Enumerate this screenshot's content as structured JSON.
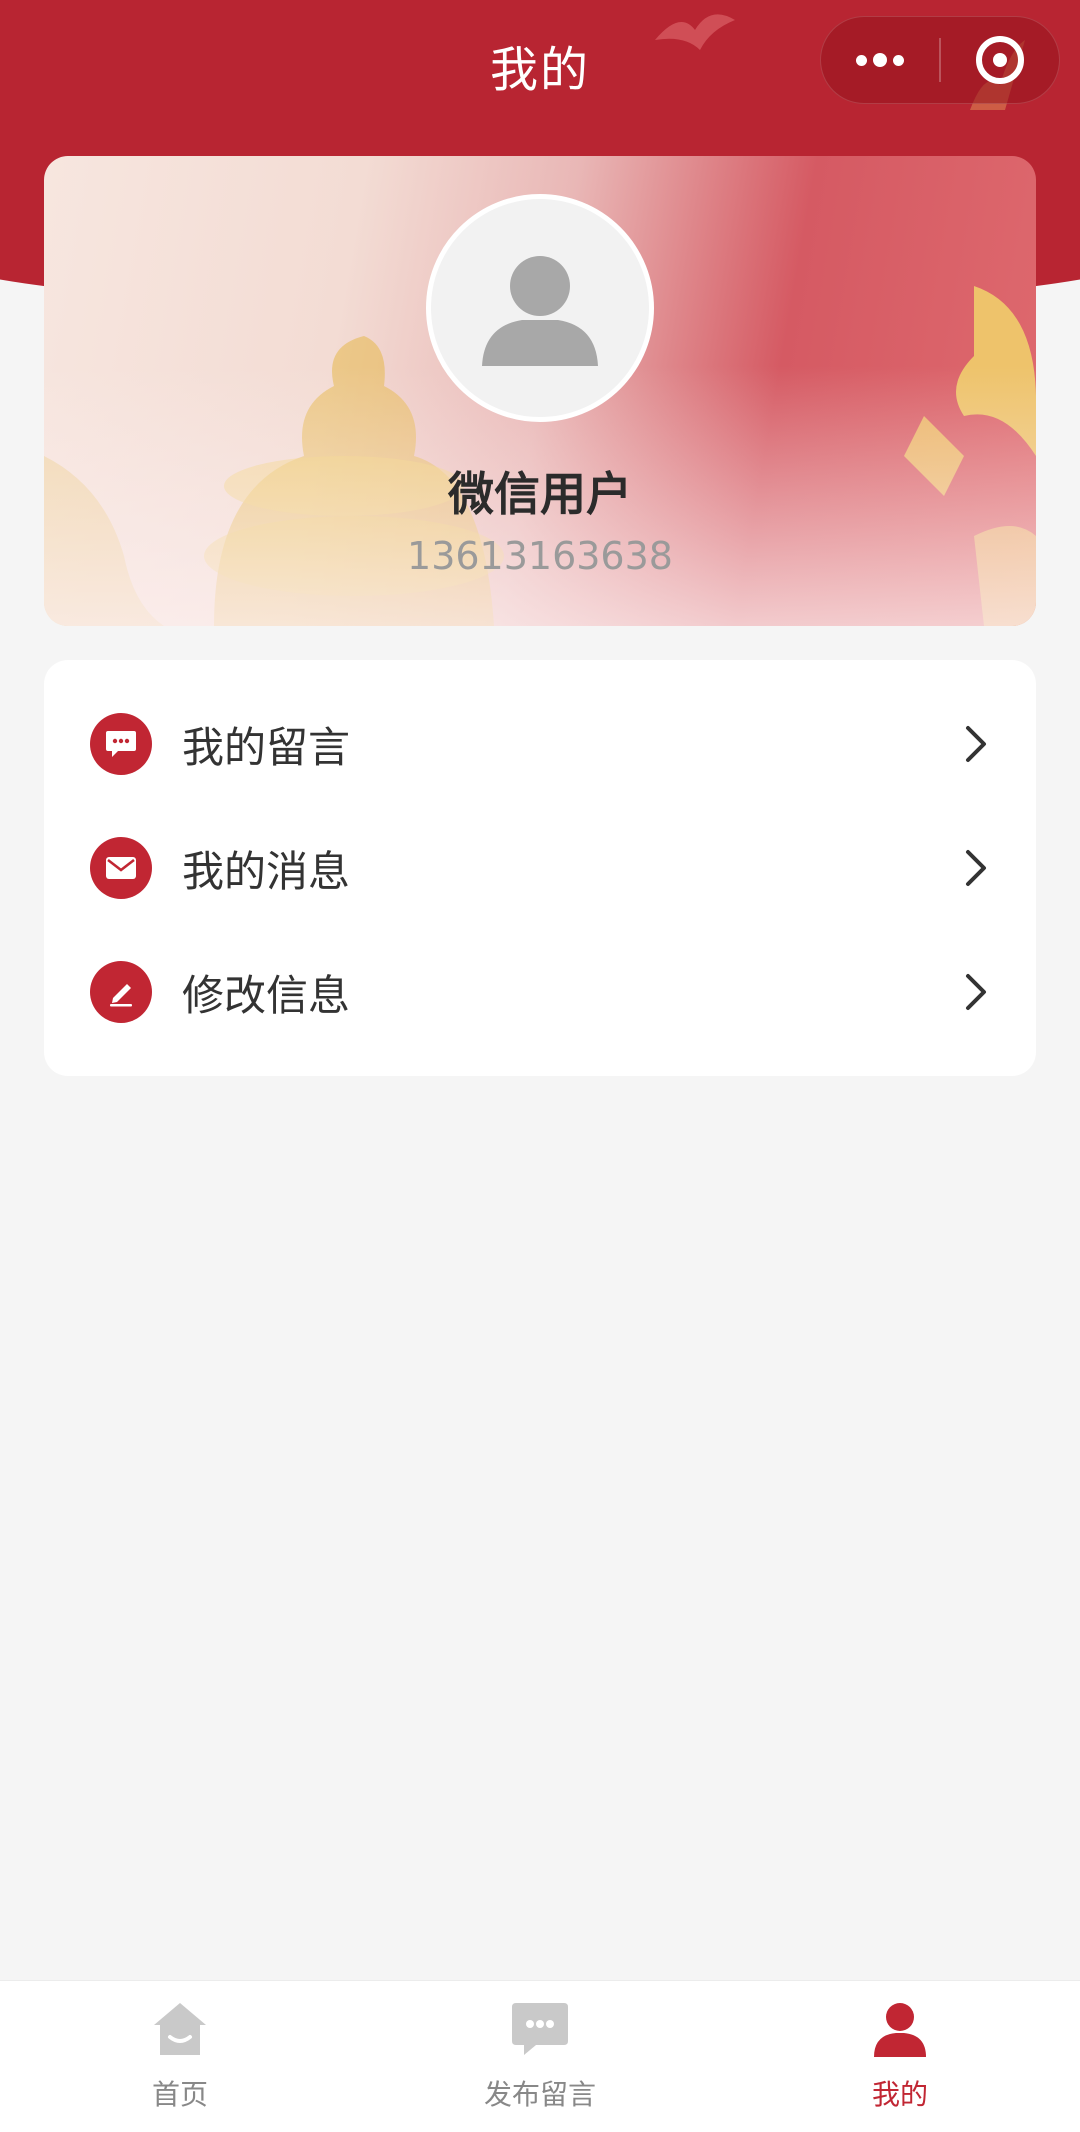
{
  "nav": {
    "title": "我的"
  },
  "profile": {
    "name": "微信用户",
    "phone": "13613163638"
  },
  "menu": {
    "items": [
      {
        "label": "我的留言",
        "icon": "message-bubble-icon"
      },
      {
        "label": "我的消息",
        "icon": "envelope-icon"
      },
      {
        "label": "修改信息",
        "icon": "edit-pencil-icon"
      }
    ]
  },
  "tabbar": {
    "tabs": [
      {
        "label": "首页",
        "icon": "home-icon",
        "active": false
      },
      {
        "label": "发布留言",
        "icon": "chat-bubble-icon",
        "active": false
      },
      {
        "label": "我的",
        "icon": "user-icon",
        "active": true
      }
    ]
  },
  "colors": {
    "accent": "#c12633",
    "header": "#b82532",
    "inactive": "#888888",
    "background": "#f5f5f5"
  }
}
